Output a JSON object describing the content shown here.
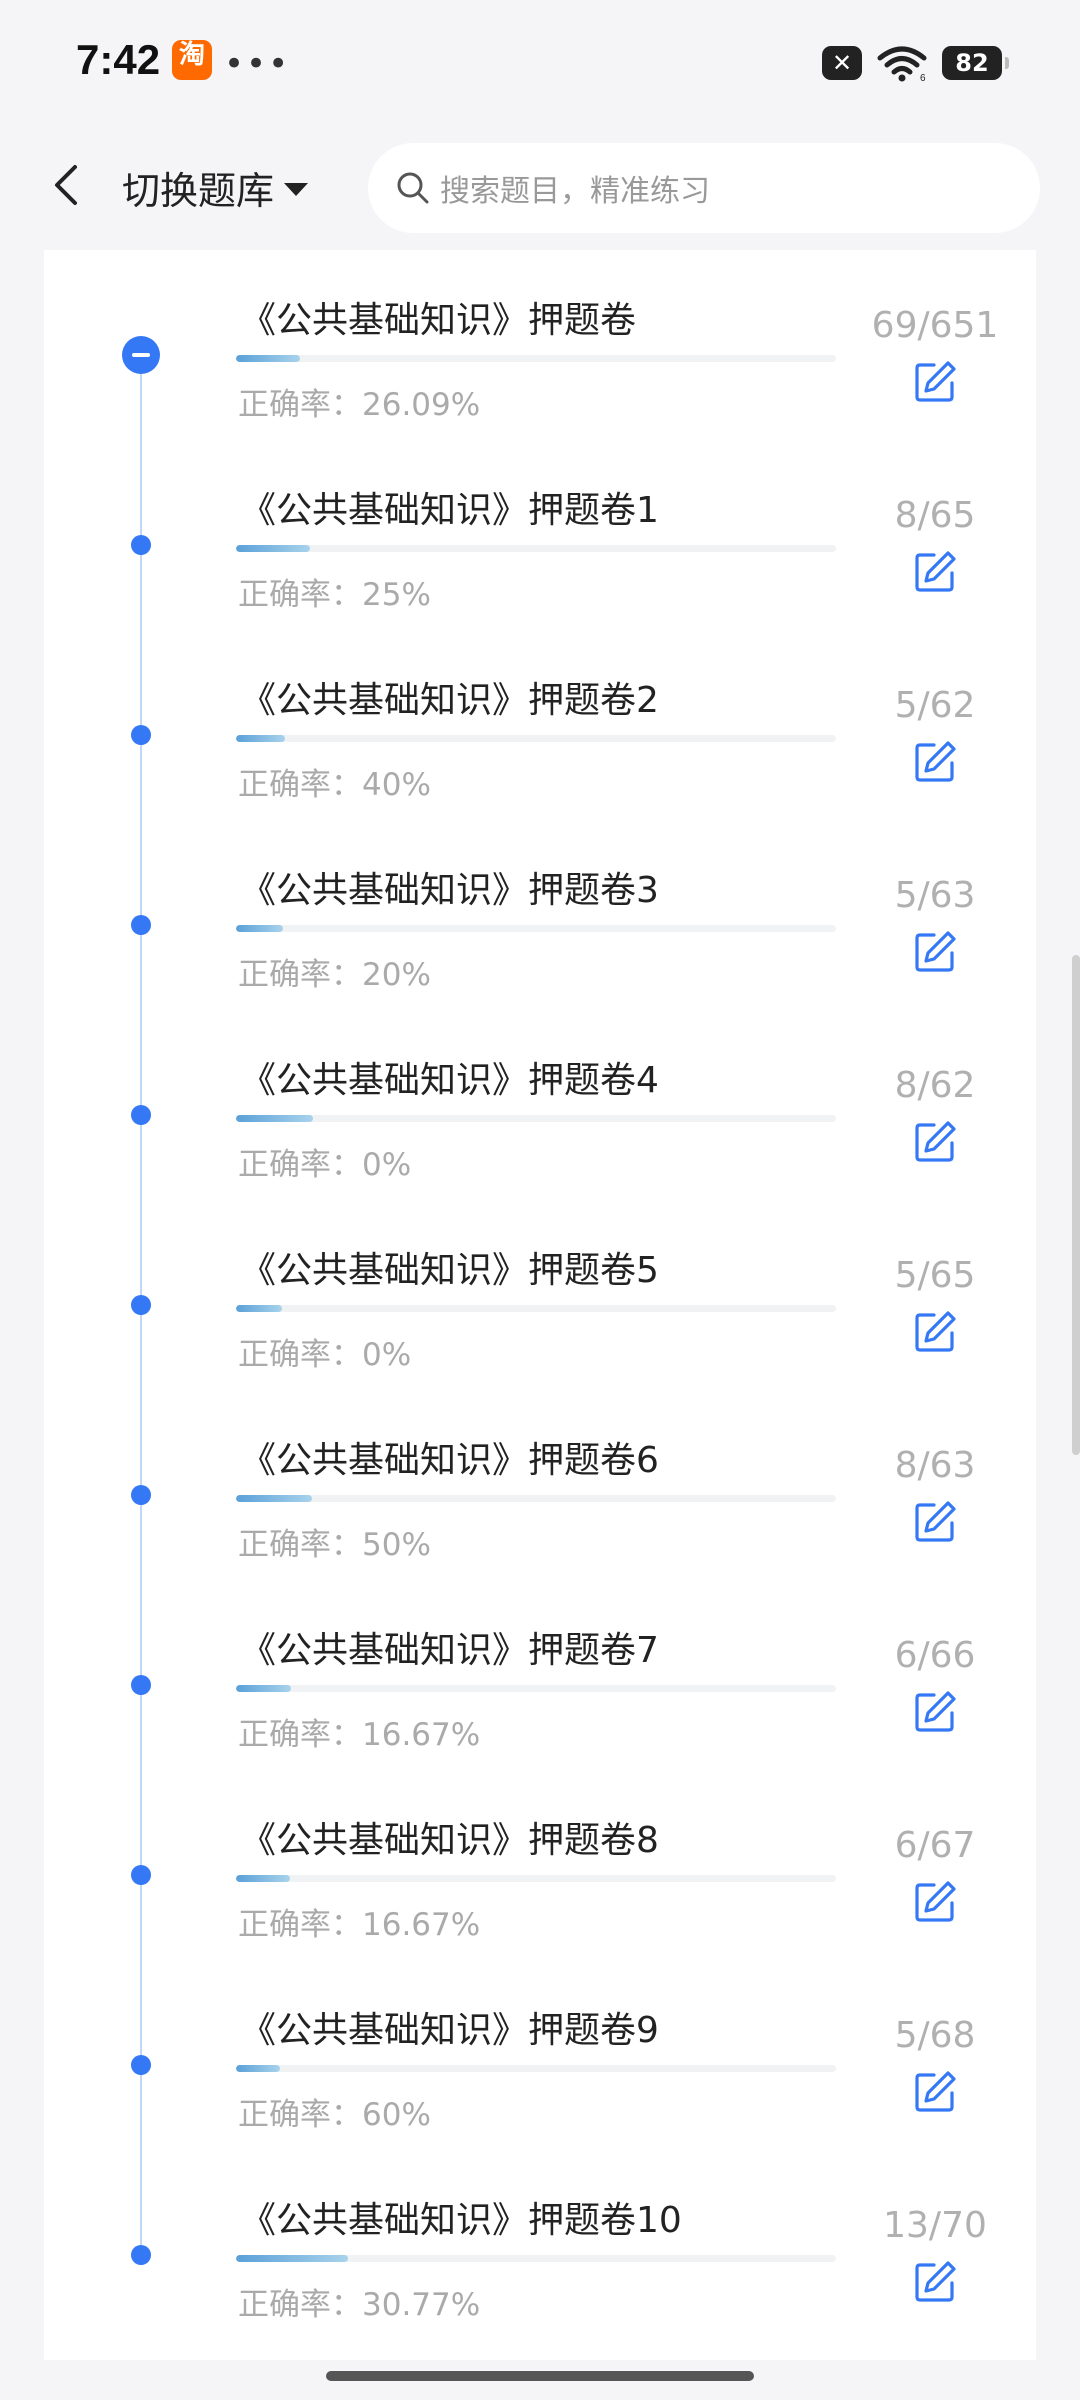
{
  "status_bar": {
    "time": "7:42",
    "battery": "82",
    "icons": [
      "taobao-app-icon",
      "more-dots-icon",
      "close-badge-icon",
      "wifi-icon",
      "battery-icon"
    ]
  },
  "header": {
    "title": "切换题库",
    "search_placeholder": "搜索题目，精准练习"
  },
  "items": [
    {
      "title": "《公共基础知识》押题卷",
      "accuracy": "正确率：26.09%",
      "count": "69/651",
      "progress": 0.106
    },
    {
      "title": "《公共基础知识》押题卷1",
      "accuracy": "正确率：25%",
      "count": "8/65",
      "progress": 0.123
    },
    {
      "title": "《公共基础知识》押题卷2",
      "accuracy": "正确率：40%",
      "count": "5/62",
      "progress": 0.081
    },
    {
      "title": "《公共基础知识》押题卷3",
      "accuracy": "正确率：20%",
      "count": "5/63",
      "progress": 0.079
    },
    {
      "title": "《公共基础知识》押题卷4",
      "accuracy": "正确率：0%",
      "count": "8/62",
      "progress": 0.129
    },
    {
      "title": "《公共基础知识》押题卷5",
      "accuracy": "正确率：0%",
      "count": "5/65",
      "progress": 0.077
    },
    {
      "title": "《公共基础知识》押题卷6",
      "accuracy": "正确率：50%",
      "count": "8/63",
      "progress": 0.127
    },
    {
      "title": "《公共基础知识》押题卷7",
      "accuracy": "正确率：16.67%",
      "count": "6/66",
      "progress": 0.091
    },
    {
      "title": "《公共基础知识》押题卷8",
      "accuracy": "正确率：16.67%",
      "count": "6/67",
      "progress": 0.09
    },
    {
      "title": "《公共基础知识》押题卷9",
      "accuracy": "正确率：60%",
      "count": "5/68",
      "progress": 0.074
    },
    {
      "title": "《公共基础知识》押题卷10",
      "accuracy": "正确率：30.77%",
      "count": "13/70",
      "progress": 0.186
    }
  ],
  "colors": {
    "accent": "#3478f6",
    "progress_start": "#5aa0d8",
    "progress_end": "#a8d3ec"
  }
}
